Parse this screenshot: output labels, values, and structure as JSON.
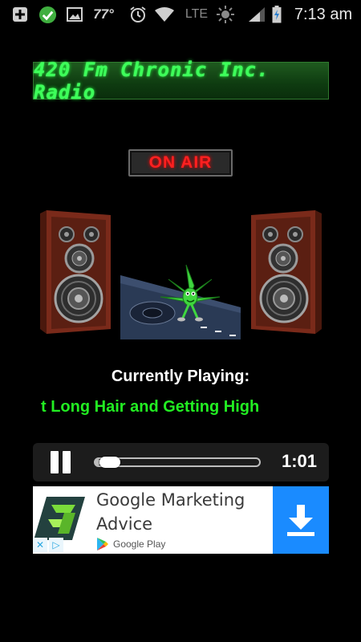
{
  "status_bar": {
    "icons": [
      "add-icon",
      "check-icon",
      "image-icon",
      "alarm-icon",
      "wifi-icon",
      "brightness-icon",
      "signal-icon",
      "battery-charging-icon"
    ],
    "temperature": "77°",
    "network": "LTE",
    "time": "7:13 am"
  },
  "station": {
    "name": "420 Fm Chronic Inc. Radio",
    "on_air": "ON AIR"
  },
  "now_playing": {
    "label": "Currently Playing:",
    "title": "t Long Hair and Getting High"
  },
  "player": {
    "time": "1:01",
    "progress": 0.03,
    "icon": "pause-icon"
  },
  "ad": {
    "title": "Google Marketing Advice",
    "store": "Google Play",
    "button_icon": "download-icon",
    "choices_icons": [
      "close-icon",
      "adchoices-icon"
    ]
  },
  "colors": {
    "station_green": "#3dff5a",
    "on_air_red": "#ff2020",
    "track_green": "#22ee22",
    "ad_blue": "#1a8bff"
  }
}
